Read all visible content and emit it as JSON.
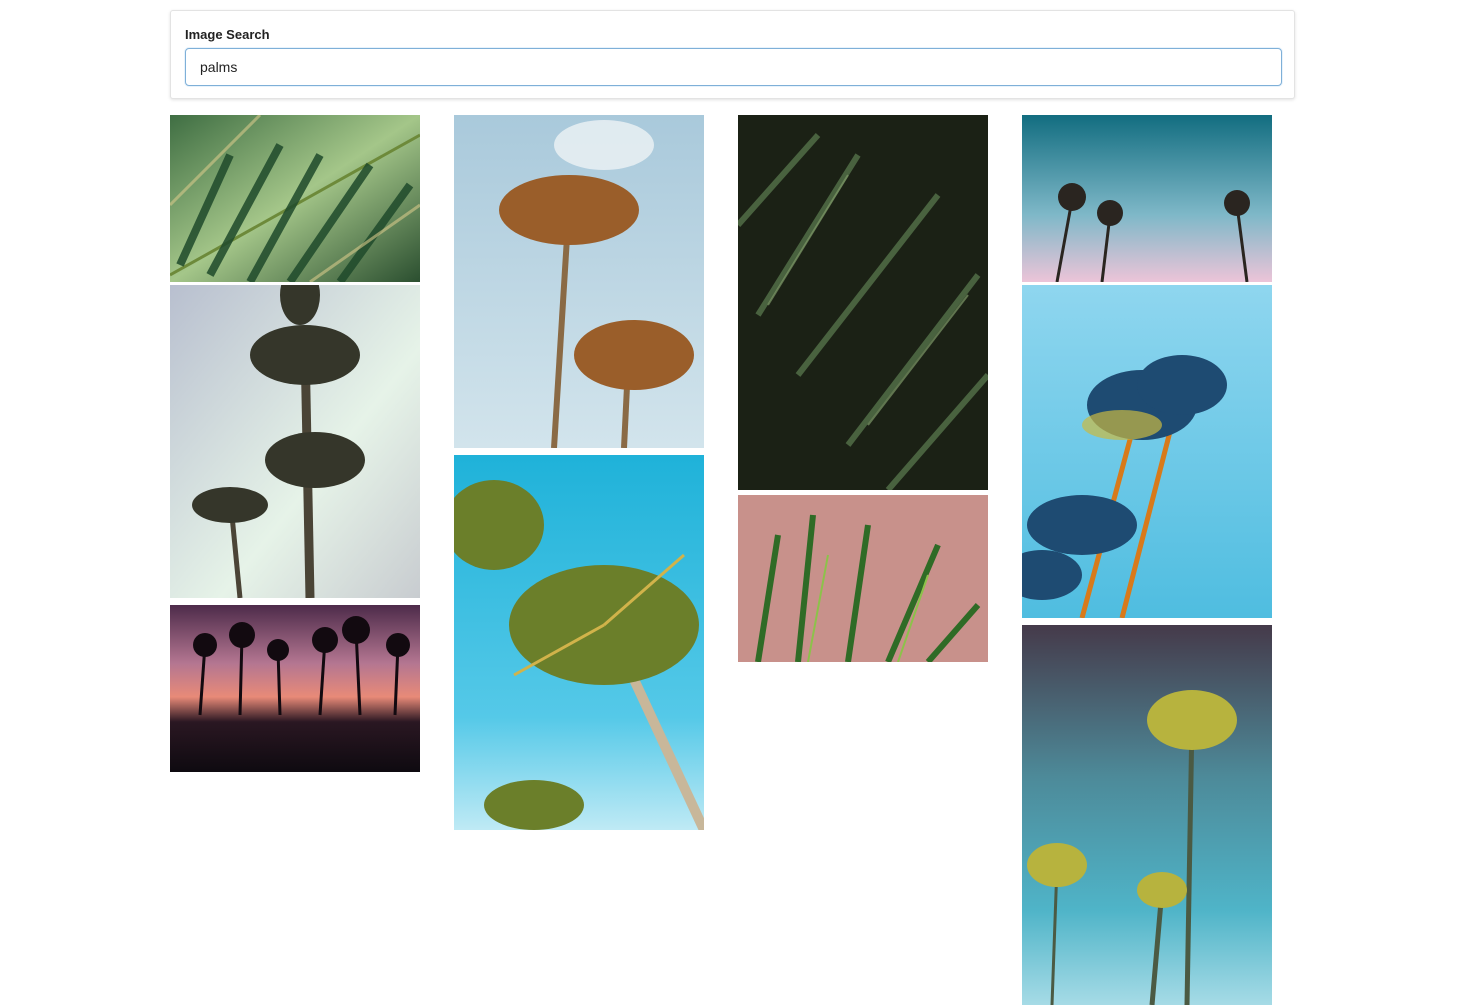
{
  "search": {
    "label": "Image Search",
    "value": "palms"
  },
  "results": [
    {
      "name": "palm-fronds-green-closeup",
      "colors": [
        "#2c5a38",
        "#8fbf7e"
      ]
    },
    {
      "name": "palms-from-below-pale-sky",
      "colors": [
        "#c9d2dc",
        "#3b3a2e"
      ]
    },
    {
      "name": "palm-sunset-reflection",
      "colors": [
        "#a06a86",
        "#140d14"
      ]
    },
    {
      "name": "coconut-palms-blue-sky",
      "colors": [
        "#b7d3e0",
        "#8a5a2b"
      ]
    },
    {
      "name": "palms-cyan-sky",
      "colors": [
        "#2cb6d8",
        "#6e8a2a"
      ]
    },
    {
      "name": "dark-green-fern-palm",
      "colors": [
        "#1c2216",
        "#56704a"
      ]
    },
    {
      "name": "palm-leaves-pink-wall",
      "colors": [
        "#c98f8a",
        "#3d7a2c"
      ]
    },
    {
      "name": "three-palms-teal-pink-sky",
      "colors": [
        "#1a7f93",
        "#e8c3d6"
      ]
    },
    {
      "name": "palms-bright-blue-sky",
      "colors": [
        "#6cc8e6",
        "#1d4d78"
      ]
    },
    {
      "name": "tall-palms-gradient-sky",
      "colors": [
        "#4b3f52",
        "#58b9c9"
      ]
    }
  ]
}
